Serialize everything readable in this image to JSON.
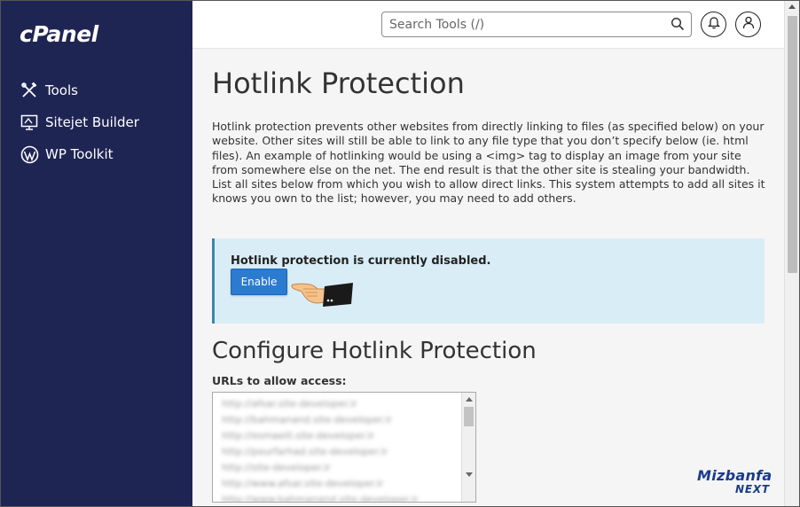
{
  "sidebar": {
    "logo": "cPanel",
    "items": [
      {
        "label": "Tools",
        "icon": "tools-icon"
      },
      {
        "label": "Sitejet Builder",
        "icon": "sitejet-icon"
      },
      {
        "label": "WP Toolkit",
        "icon": "wordpress-icon"
      }
    ]
  },
  "header": {
    "search_placeholder": "Search Tools (/)",
    "search_value": ""
  },
  "page": {
    "title": "Hotlink Protection",
    "description": "Hotlink protection prevents other websites from directly linking to files (as specified below) on your website. Other sites will still be able to link to any file type that you don’t specify below (ie. html files). An example of hotlinking would be using a <img> tag to display an image from your site from somewhere else on the net. The end result is that the other site is stealing your bandwidth. List all sites below from which you wish to allow direct links. This system attempts to add all sites it knows you own to the list; however, you may need to add others.",
    "status_message": "Hotlink protection is currently disabled.",
    "enable_label": "Enable",
    "section_title": "Configure Hotlink Protection",
    "urls_label": "URLs to allow access:",
    "urls": [
      "http://afsar.site-developer.ir",
      "http://bahmanand.site-developer.ir",
      "http://esmaeili.site-developer.ir",
      "http://pourfarhad.site-developer.ir",
      "http://site-developer.ir",
      "http://www.afsar.site-developer.ir",
      "http://www.bahmanand.site-developer.ir"
    ]
  },
  "watermark": {
    "top": "Mizbanfa",
    "bottom": "NEXT"
  },
  "colors": {
    "sidebar_bg": "#1f2553",
    "alert_bg": "#d9edf7",
    "button": "#2b7bd0"
  }
}
